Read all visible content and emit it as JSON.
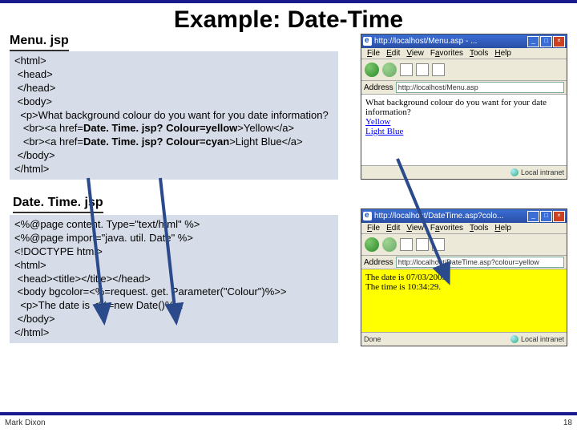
{
  "title": "Example: Date-Time",
  "sections": {
    "menu": "Menu. jsp",
    "datetime": "Date. Time. jsp"
  },
  "code1": {
    "l1": "<html>",
    "l2": " <head>",
    "l3": " </head>",
    "l4": " <body>",
    "l5": "  <p>What background colour do you want for you date information?",
    "l6": "   <br><a href=",
    "b1": "Date. Time. jsp? Colour=yellow",
    "l6b": ">Yellow</a>",
    "l7": "   <br><a href=",
    "b2": "Date. Time. jsp? Colour=cyan",
    "l7b": ">Light Blue</a>",
    "l8": " </body>",
    "l9": "</html>"
  },
  "code2": {
    "l1": "<%@page content. Type=\"text/html\" %>",
    "l2": "<%@page import=\"java. util. Date\" %>",
    "l3": "<!DOCTYPE html>",
    "l4": "<html>",
    "l5": " <head><title></title></head>",
    "l6": " <body bgcolor=<%=request. get. Parameter(\"Colour\")%>>",
    "l7": "  <p>The date is <%=new Date()%>.",
    "l8": " </body>",
    "l9": "</html>"
  },
  "browser1": {
    "title": "http://localhost/Menu.asp - ...",
    "address": "http://localhost/Menu.asp",
    "body": {
      "q": "What background colour do you want for your date information?",
      "a1": "Yellow",
      "a2": "Light Blue"
    },
    "status": "Local intranet"
  },
  "browser2": {
    "title": "http://localhost/DateTime.asp?colo...",
    "address": "http://localhost/DateTime.asp?colour=yellow",
    "body": {
      "l1": "The date is 07/03/2005.",
      "l2": "The time is 10:34:29."
    },
    "status": "Local intranet",
    "done": "Done"
  },
  "menus": {
    "file": "File",
    "edit": "Edit",
    "view": "View",
    "fav": "Favorites",
    "tools": "Tools",
    "help": "Help"
  },
  "addrlabel": "Address",
  "footer": {
    "author": "Mark Dixon",
    "page": "18"
  }
}
